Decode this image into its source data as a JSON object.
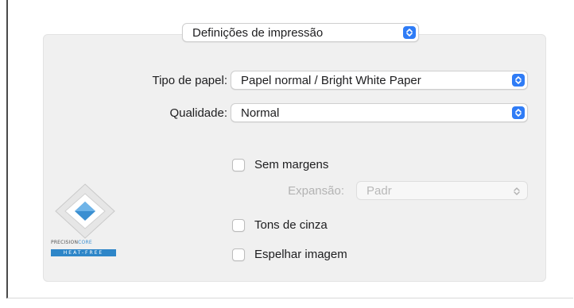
{
  "header": {
    "section_popup": "Definições de impressão"
  },
  "form": {
    "paper_type_label": "Tipo de papel:",
    "paper_type_value": "Papel normal / Bright White Paper",
    "quality_label": "Qualidade:",
    "quality_value": "Normal"
  },
  "options": {
    "borderless_label": "Sem margens",
    "borderless_checked": false,
    "expansion_label": "Expansão:",
    "expansion_value": "Padr",
    "grayscale_label": "Tons de cinza",
    "grayscale_checked": false,
    "mirror_label": "Espelhar imagem",
    "mirror_checked": false
  },
  "logo": {
    "brand_a": "PRECISION",
    "brand_b": "CORE",
    "tagline": "HEAT-FREE"
  },
  "colors": {
    "accent": "#2f7cf6",
    "panel_bg": "#f0f0f0",
    "logo_blue": "#2e86c8"
  }
}
